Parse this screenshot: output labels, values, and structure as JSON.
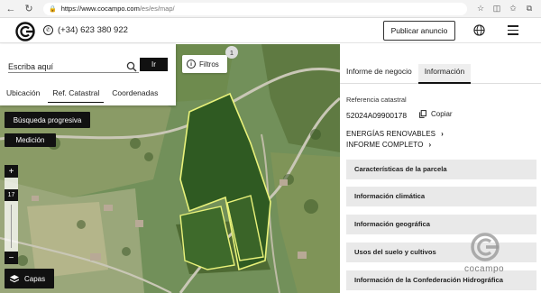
{
  "browser": {
    "url_host": "https://www.cocampo.com",
    "url_path": "/es/es/map/"
  },
  "header": {
    "phone": "(+34) 623 380 922",
    "publish_label": "Publicar anuncio"
  },
  "search": {
    "placeholder": "Escriba aquí",
    "go_label": "Ir",
    "tabs": [
      {
        "label": "Ubicación",
        "active": false
      },
      {
        "label": "Ref. Catastral",
        "active": true
      },
      {
        "label": "Coordenadas",
        "active": false
      }
    ]
  },
  "map_controls": {
    "filters_label": "Filtros",
    "filters_badge": "1",
    "progressive_label": "Búsqueda progresiva",
    "measure_label": "Medición",
    "zoom_in": "+",
    "zoom_out": "−",
    "zoom_level": "17",
    "layers_label": "Capas"
  },
  "panel": {
    "tabs": [
      {
        "label": "Informe de negocio",
        "active": false
      },
      {
        "label": "Información",
        "active": true
      }
    ],
    "ref_label": "Referencia catastral",
    "ref_value": "52024A09900178",
    "copy_label": "Copiar",
    "links": [
      "ENERGÍAS RENOVABLES",
      "INFORME COMPLETO"
    ],
    "sections": [
      "Características de la parcela",
      "Información climática",
      "Información geográfica",
      "Usos del suelo y cultivos",
      "Información de la Confederación Hidrográfica"
    ]
  },
  "watermark": "cocampo",
  "colors": {
    "parcel_outline": "#e9f27a",
    "accent": "#111111"
  }
}
